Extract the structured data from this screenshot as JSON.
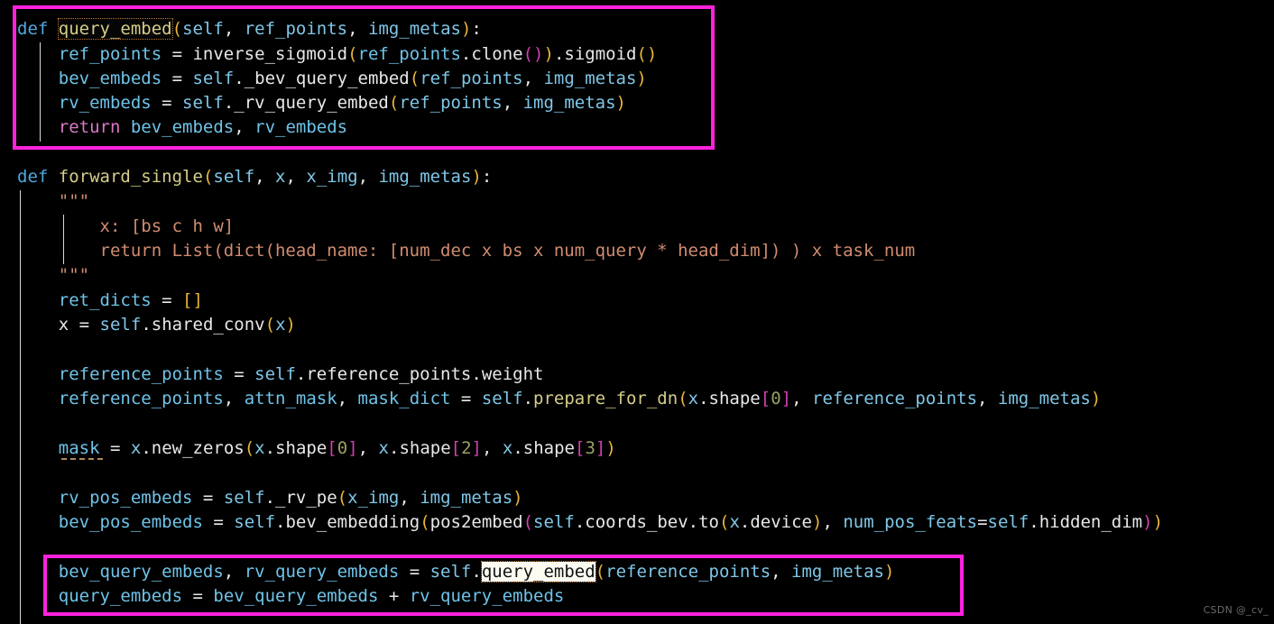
{
  "editor": {
    "background": "#000000",
    "foreground": "#e8e8e8",
    "highlight_box_color": "#ff22dd",
    "occurrence_outline_color": "#c07a34",
    "selection_background": "#fbfbf2"
  },
  "watermark": "CSDN @_cv_",
  "code": {
    "block_top": {
      "lines": [
        "def query_embed(self, ref_points, img_metas):",
        "    ref_points = inverse_sigmoid(ref_points.clone()).sigmoid()",
        "    bev_embeds = self._bev_query_embed(ref_points, img_metas)",
        "    rv_embeds = self._rv_query_embed(ref_points, img_metas)",
        "    return bev_embeds, rv_embeds"
      ]
    },
    "block_main": {
      "lines": [
        "def forward_single(self, x, x_img, img_metas):",
        "    \"\"\"",
        "        x: [bs c h w]",
        "        return List(dict(head_name: [num_dec x bs x num_query * head_dim]) ) x task_num",
        "    \"\"\"",
        "    ret_dicts = []",
        "    x = self.shared_conv(x)",
        "",
        "    reference_points = self.reference_points.weight",
        "    reference_points, attn_mask, mask_dict = self.prepare_for_dn(x.shape[0], reference_points, img_metas)",
        "",
        "    mask = x.new_zeros(x.shape[0], x.shape[2], x.shape[3])",
        "",
        "    rv_pos_embeds = self._rv_pe(x_img, img_metas)",
        "    bev_pos_embeds = self.bev_embedding(pos2embed(self.coords_bev.to(x.device), num_pos_feats=self.hidden_dim))",
        "",
        "    bev_query_embeds, rv_query_embeds = self.query_embed(reference_points, img_metas)",
        "    query_embeds = bev_query_embeds + rv_query_embeds"
      ]
    },
    "tokens": {
      "def": "def",
      "return": "return",
      "query_embed": "query_embed",
      "forward_single": "forward_single",
      "self": "self",
      "ref_points": "ref_points",
      "img_metas": "img_metas",
      "inverse_sigmoid": "inverse_sigmoid",
      "clone": "clone",
      "sigmoid": "sigmoid",
      "bev_embeds": "bev_embeds",
      "rv_embeds": "rv_embeds",
      "_bev_query_embed": "_bev_query_embed",
      "_rv_query_embed": "_rv_query_embed",
      "x": "x",
      "x_img": "x_img",
      "docstring_open": "\"\"\"",
      "docstring_line1": "x: [bs c h w]",
      "docstring_line2": "return List(dict(head_name: [num_dec x bs x num_query * head_dim]) ) x task_num",
      "docstring_close": "\"\"\"",
      "ret_dicts": "ret_dicts",
      "shared_conv": "shared_conv",
      "reference_points": "reference_points",
      "weight": "weight",
      "attn_mask": "attn_mask",
      "mask_dict": "mask_dict",
      "prepare_for_dn": "prepare_for_dn",
      "shape": "shape",
      "mask": "mask",
      "new_zeros": "new_zeros",
      "rv_pos_embeds": "rv_pos_embeds",
      "_rv_pe": "_rv_pe",
      "bev_pos_embeds": "bev_pos_embeds",
      "bev_embedding": "bev_embedding",
      "pos2embed": "pos2embed",
      "coords_bev": "coords_bev",
      "to": "to",
      "device": "device",
      "num_pos_feats": "num_pos_feats",
      "hidden_dim": "hidden_dim",
      "bev_query_embeds": "bev_query_embeds",
      "rv_query_embeds": "rv_query_embeds",
      "query_embeds": "query_embeds",
      "num0": "0",
      "num2": "2",
      "num3": "3"
    }
  }
}
